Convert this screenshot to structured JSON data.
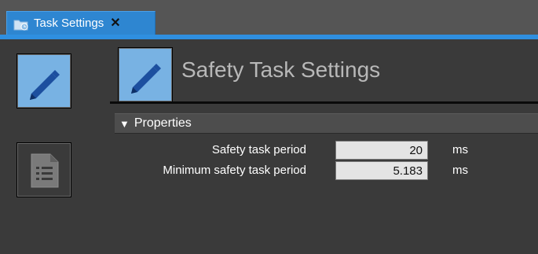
{
  "tab": {
    "label": "Task Settings",
    "close_label": "✕",
    "icon": "folder-clock-icon"
  },
  "nav": {
    "items": [
      {
        "icon": "pencil-icon",
        "selected": true
      },
      {
        "icon": "document-list-icon",
        "selected": false
      }
    ]
  },
  "main": {
    "title": "Safety Task Settings",
    "title_icon": "pencil-icon",
    "section": {
      "arrow": "▼",
      "label": "Properties"
    },
    "properties": [
      {
        "label": "Safety task period",
        "value": "20",
        "unit": "ms"
      },
      {
        "label": "Minimum safety task period",
        "value": "5.183",
        "unit": "ms"
      }
    ]
  },
  "colors": {
    "tab_active": "#2e86d1",
    "stripe": "#2f8fe0",
    "icon_bg": "#78b2e3",
    "panel_bg": "#3a3a3a",
    "title_text": "#b8b8b8"
  }
}
